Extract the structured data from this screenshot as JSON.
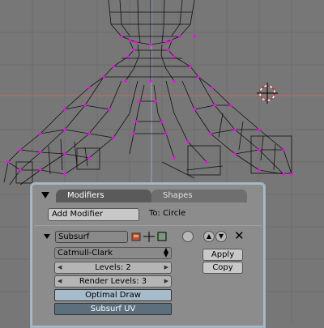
{
  "tabs": {
    "modifiers": "Modifiers",
    "shapes": "Shapes"
  },
  "toolbar": {
    "add_modifier": "Add Modifier",
    "target": "To: Circle"
  },
  "modifier": {
    "name": "Subsurf",
    "algorithm": "Catmull-Clark",
    "levels": "Levels: 2",
    "render_levels": "Render Levels: 3",
    "optimal_draw": "Optimal Draw",
    "subsurf_uv": "Subsurf UV",
    "apply": "Apply",
    "copy": "Copy"
  },
  "icons": {
    "panel_toggle": "triangle-down-icon",
    "realtime": "realtime-display-icon",
    "editmode": "editmode-icon",
    "cage": "cage-icon",
    "move_up": "chevron-up-icon",
    "move_down": "chevron-down-icon",
    "delete": "close-icon"
  },
  "colors": {
    "viewport_bg": "#777777",
    "wire": "#000000",
    "vertex": "#ff00ff",
    "axis_x": "#c46b6b",
    "axis_y": "#9aa6c4",
    "toggle_on": "#a6bccb",
    "toggle_off": "#5b6f7c"
  }
}
